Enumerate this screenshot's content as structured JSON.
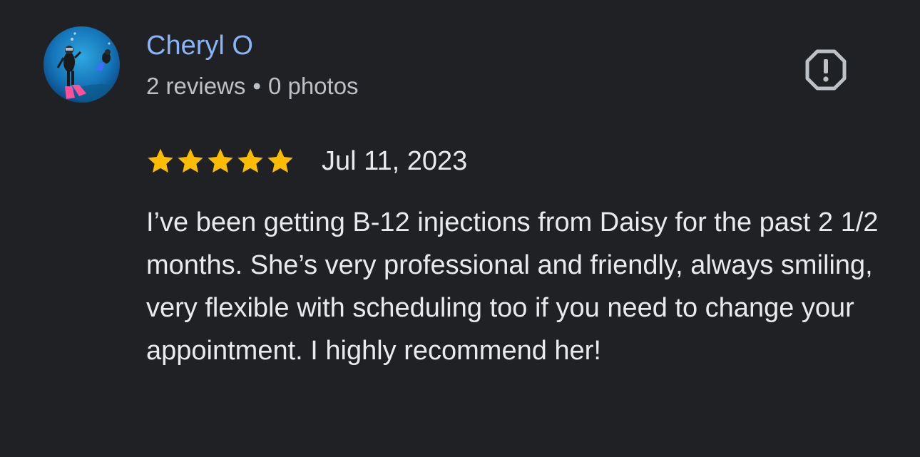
{
  "reviewer": {
    "name": "Cheryl O",
    "reviews_count": "2 reviews",
    "separator": "•",
    "photos_count": "0 photos",
    "avatar_icon": "avatar-photo-scuba-diver"
  },
  "actions": {
    "report_icon": "report-icon"
  },
  "review": {
    "rating": 5,
    "rating_max": 5,
    "date": "Jul 11, 2023",
    "text": "I’ve been getting B-12 injections from Daisy for the past 2 1/2 months. She’s very professional and friendly, always smiling, very flexible with scheduling too if you need to change your appointment. I highly recommend her!"
  },
  "colors": {
    "background": "#202124",
    "name_link": "#8ab4f8",
    "meta_text": "#bdc1c6",
    "body_text": "#e8eaed",
    "star": "#fbbc04",
    "report_icon": "#bdc1c6"
  }
}
